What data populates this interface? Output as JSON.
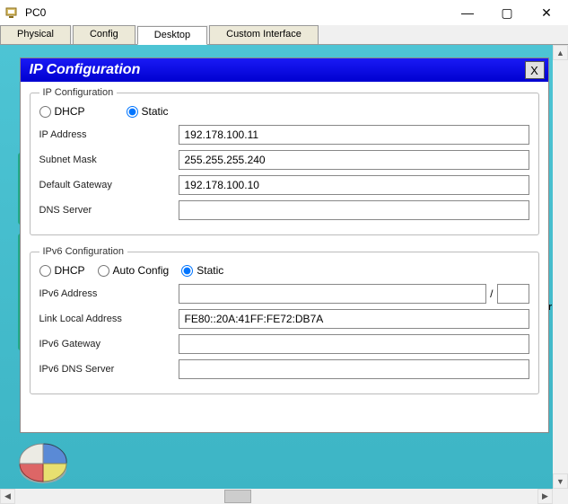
{
  "window": {
    "title": "PC0",
    "controls": {
      "min": "—",
      "max": "▢",
      "close": "✕"
    }
  },
  "tabs": [
    "Physical",
    "Config",
    "Desktop",
    "Custom Interface"
  ],
  "active_tab": "Desktop",
  "bg_label": "or",
  "dialog": {
    "title": "IP Configuration",
    "close_label": "X",
    "ipv4": {
      "legend": "IP Configuration",
      "mode_dhcp": "DHCP",
      "mode_static": "Static",
      "mode_selected": "static",
      "fields": {
        "ip_label": "IP Address",
        "ip_value": "192.178.100.11",
        "mask_label": "Subnet Mask",
        "mask_value": "255.255.255.240",
        "gw_label": "Default Gateway",
        "gw_value": "192.178.100.10",
        "dns_label": "DNS Server",
        "dns_value": ""
      }
    },
    "ipv6": {
      "legend": "IPv6 Configuration",
      "mode_dhcp": "DHCP",
      "mode_auto": "Auto Config",
      "mode_static": "Static",
      "mode_selected": "static",
      "fields": {
        "addr_label": "IPv6 Address",
        "addr_value": "",
        "prefix_sep": "/",
        "prefix_value": "",
        "lla_label": "Link Local Address",
        "lla_value": "FE80::20A:41FF:FE72:DB7A",
        "gw_label": "IPv6 Gateway",
        "gw_value": "",
        "dns_label": "IPv6 DNS Server",
        "dns_value": ""
      }
    }
  }
}
